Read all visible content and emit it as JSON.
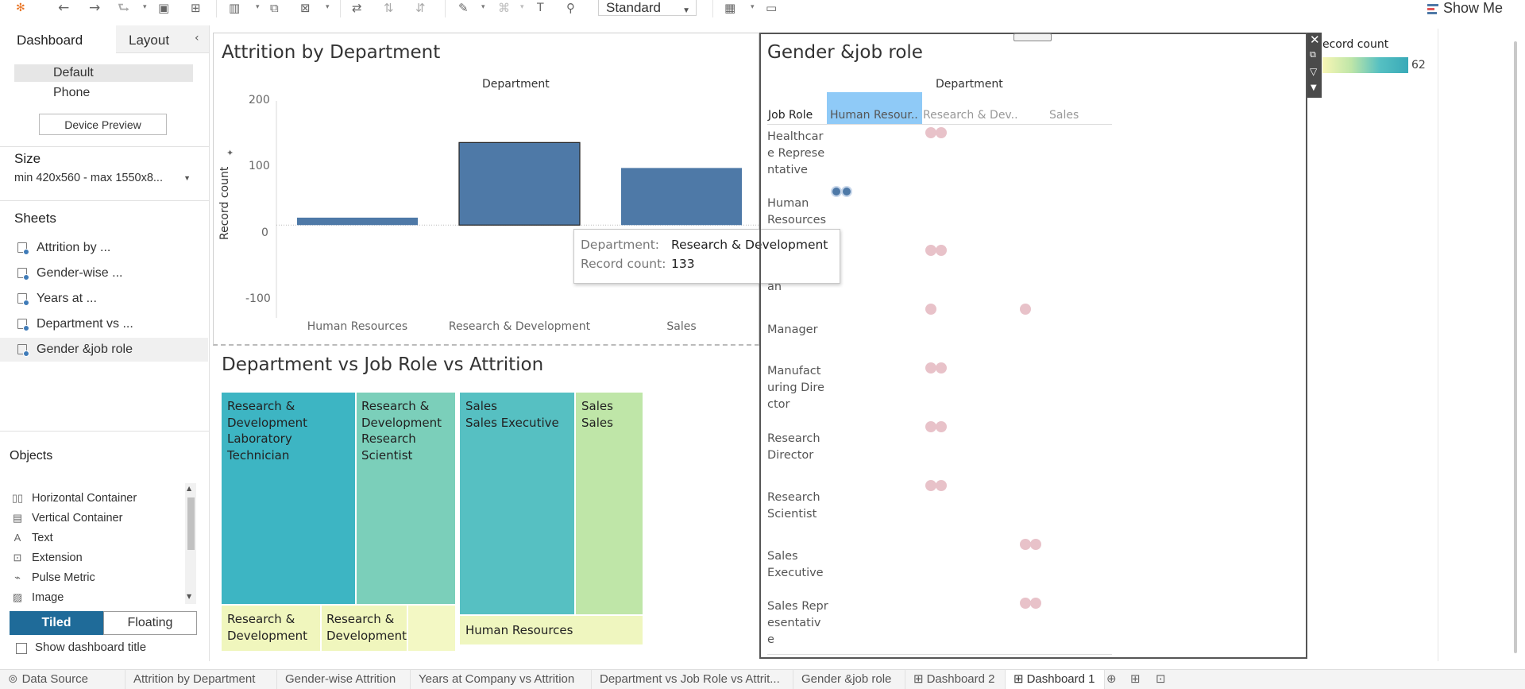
{
  "toolbar": {
    "view_mode": "Standard",
    "show_me": "Show Me"
  },
  "left_pane": {
    "tabs": {
      "dashboard": "Dashboard",
      "layout": "Layout"
    },
    "devices": [
      "Default",
      "Phone"
    ],
    "device_preview": "Device Preview",
    "size_heading": "Size",
    "size_value": "min 420x560 - max 1550x8...",
    "sheets_heading": "Sheets",
    "sheets": [
      "Attrition by ...",
      "Gender-wise ...",
      "Years at ...",
      "Department vs ...",
      "Gender &job role"
    ],
    "objects_heading": "Objects",
    "objects": [
      {
        "label": "Horizontal Container",
        "icon": "horizontal-container-icon"
      },
      {
        "label": "Vertical Container",
        "icon": "vertical-container-icon"
      },
      {
        "label": "Text",
        "icon": "text-icon"
      },
      {
        "label": "Extension",
        "icon": "extension-icon"
      },
      {
        "label": "Pulse Metric",
        "icon": "pulse-metric-icon"
      },
      {
        "label": "Image",
        "icon": "image-icon"
      }
    ],
    "tiled": "Tiled",
    "floating": "Floating",
    "show_dashboard_title": "Show dashboard title"
  },
  "attrition_chart": {
    "title": "Attrition by Department",
    "header": "Department",
    "y_label": "Record count",
    "y_ticks": [
      "200",
      "100",
      "0",
      "-100"
    ],
    "tooltip": {
      "dept_label": "Department:",
      "dept_value": "Research & Development",
      "count_label": "Record count:",
      "count_value": "133"
    }
  },
  "chart_data": {
    "type": "bar",
    "title": "Attrition by Department",
    "xlabel": "Department",
    "ylabel": "Record count",
    "categories": [
      "Human Resources",
      "Research & Development",
      "Sales"
    ],
    "values": [
      12,
      133,
      92
    ],
    "ylim": [
      -120,
      200
    ],
    "color": "#4e79a7",
    "selected": "Research & Development"
  },
  "treemap": {
    "title": "Department vs Job Role vs Attrition",
    "cells": [
      {
        "text": "Research &\nDevelopment\nLaboratory\nTechnician",
        "color": "#3db5c3"
      },
      {
        "text": "Research &\nDevelopment\nResearch\nScientist",
        "color": "#7bcfba"
      },
      {
        "text": "Sales\nSales Executive",
        "color": "#56c0c2"
      },
      {
        "text": "Sales\nSales",
        "color": "#bfe6a8"
      },
      {
        "text": "Research &\nDevelopment",
        "color": "#f0f6bd"
      },
      {
        "text": "Research &\nDevelopment",
        "color": "#f0f6bd"
      },
      {
        "text": "",
        "color": "#f3f8c4"
      },
      {
        "text": "Human Resources",
        "color": "#eff6bf"
      }
    ]
  },
  "gender_role": {
    "title": "Gender &job role",
    "header": "Department",
    "row_header": "Job Role",
    "columns": [
      "Human Resour..",
      "Research & Dev..",
      "Sales"
    ],
    "rows": [
      "Healthcar\ne Represe\nntative",
      "Human\nResources",
      "an",
      "Manager",
      "Manufact\nuring Dire\nctor",
      "Research\nDirector",
      "Research\nScientist",
      "Sales\nExecutive",
      "Sales Repr\nesentativ\ne"
    ],
    "dot_color": "#e8c2c9",
    "dot_selected_color": "#4e79a7"
  },
  "legend": {
    "title": "ecord count",
    "max": "62"
  },
  "bottom_tabs": [
    "Data Source",
    "Attrition by Department",
    "Gender-wise Attrition",
    "Years at Company vs Attrition",
    "Department vs Job Role vs Attrit...",
    "Gender &job role",
    "Dashboard 2",
    "Dashboard 1"
  ]
}
